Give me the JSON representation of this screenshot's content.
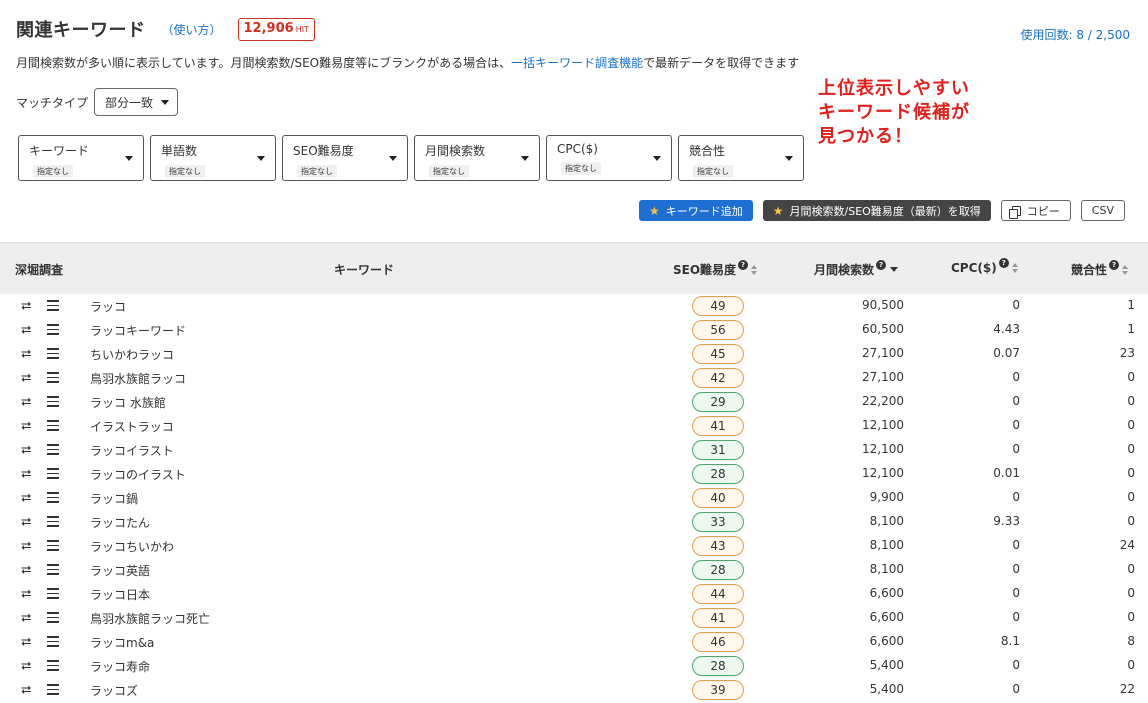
{
  "header": {
    "title": "関連キーワード",
    "howto": "（使い方）",
    "hit_count": "12,906",
    "hit_unit": "HIT",
    "usage": "使用回数: 8 / 2,500"
  },
  "description": {
    "before": "月間検索数が多い順に表示しています。月間検索数/SEO難易度等にブランクがある場合は、",
    "link": "一括キーワード調査機能",
    "after": "で最新データを取得できます"
  },
  "match": {
    "label": "マッチタイプ",
    "value": "部分一致"
  },
  "promo": [
    "上位表示しやすい",
    "キーワード候補が",
    "見つかる！"
  ],
  "filters": [
    {
      "label": "キーワード",
      "value": "指定なし"
    },
    {
      "label": "単語数",
      "value": "指定なし"
    },
    {
      "label": "SEO難易度",
      "value": "指定なし"
    },
    {
      "label": "月間検索数",
      "value": "指定なし"
    },
    {
      "label": "CPC($)",
      "value": "指定なし"
    },
    {
      "label": "競合性",
      "value": "指定なし"
    }
  ],
  "actions": {
    "add_keyword": "キーワード追加",
    "fetch_latest": "月間検索数/SEO難易度（最新）を取得",
    "copy": "コピー",
    "csv": "CSV"
  },
  "table": {
    "headers": {
      "dig": "深堀調査",
      "keyword": "キーワード",
      "seo": "SEO難易度",
      "volume": "月間検索数",
      "cpc": "CPC($)",
      "competition": "競合性"
    },
    "rows": [
      {
        "keyword": "ラッコ",
        "seo": "49",
        "seo_level": "orange",
        "volume": "90,500",
        "cpc": "0",
        "competition": "1"
      },
      {
        "keyword": "ラッコキーワード",
        "seo": "56",
        "seo_level": "orange",
        "volume": "60,500",
        "cpc": "4.43",
        "competition": "1"
      },
      {
        "keyword": "ちいかわラッコ",
        "seo": "45",
        "seo_level": "orange",
        "volume": "27,100",
        "cpc": "0.07",
        "competition": "23"
      },
      {
        "keyword": "鳥羽水族館ラッコ",
        "seo": "42",
        "seo_level": "orange",
        "volume": "27,100",
        "cpc": "0",
        "competition": "0"
      },
      {
        "keyword": "ラッコ 水族館",
        "seo": "29",
        "seo_level": "green",
        "volume": "22,200",
        "cpc": "0",
        "competition": "0"
      },
      {
        "keyword": "イラストラッコ",
        "seo": "41",
        "seo_level": "orange",
        "volume": "12,100",
        "cpc": "0",
        "competition": "0"
      },
      {
        "keyword": "ラッコイラスト",
        "seo": "31",
        "seo_level": "green",
        "volume": "12,100",
        "cpc": "0",
        "competition": "0"
      },
      {
        "keyword": "ラッコのイラスト",
        "seo": "28",
        "seo_level": "green",
        "volume": "12,100",
        "cpc": "0.01",
        "competition": "0"
      },
      {
        "keyword": "ラッコ鍋",
        "seo": "40",
        "seo_level": "orange",
        "volume": "9,900",
        "cpc": "0",
        "competition": "0"
      },
      {
        "keyword": "ラッコたん",
        "seo": "33",
        "seo_level": "green",
        "volume": "8,100",
        "cpc": "9.33",
        "competition": "0"
      },
      {
        "keyword": "ラッコちいかわ",
        "seo": "43",
        "seo_level": "orange",
        "volume": "8,100",
        "cpc": "0",
        "competition": "24"
      },
      {
        "keyword": "ラッコ英語",
        "seo": "28",
        "seo_level": "green",
        "volume": "8,100",
        "cpc": "0",
        "competition": "0"
      },
      {
        "keyword": "ラッコ日本",
        "seo": "44",
        "seo_level": "orange",
        "volume": "6,600",
        "cpc": "0",
        "competition": "0"
      },
      {
        "keyword": "鳥羽水族館ラッコ死亡",
        "seo": "41",
        "seo_level": "orange",
        "volume": "6,600",
        "cpc": "0",
        "competition": "0"
      },
      {
        "keyword": "ラッコm&a",
        "seo": "46",
        "seo_level": "orange",
        "volume": "6,600",
        "cpc": "8.1",
        "competition": "8"
      },
      {
        "keyword": "ラッコ寿命",
        "seo": "28",
        "seo_level": "green",
        "volume": "5,400",
        "cpc": "0",
        "competition": "0"
      },
      {
        "keyword": "ラッコズ",
        "seo": "39",
        "seo_level": "orange",
        "volume": "5,400",
        "cpc": "0",
        "competition": "22"
      }
    ]
  },
  "colors": {
    "link": "#1a6fc9",
    "hit_badge": "#d0301f",
    "promo": "#e0201c",
    "primary_button": "#1f6fd3",
    "seo_orange": "#e59c4d",
    "seo_green": "#48a865"
  },
  "icons": {
    "row_dig": "retweet-icon",
    "row_menu": "menu-icon",
    "star": "star-icon",
    "copy": "copy-icon"
  }
}
